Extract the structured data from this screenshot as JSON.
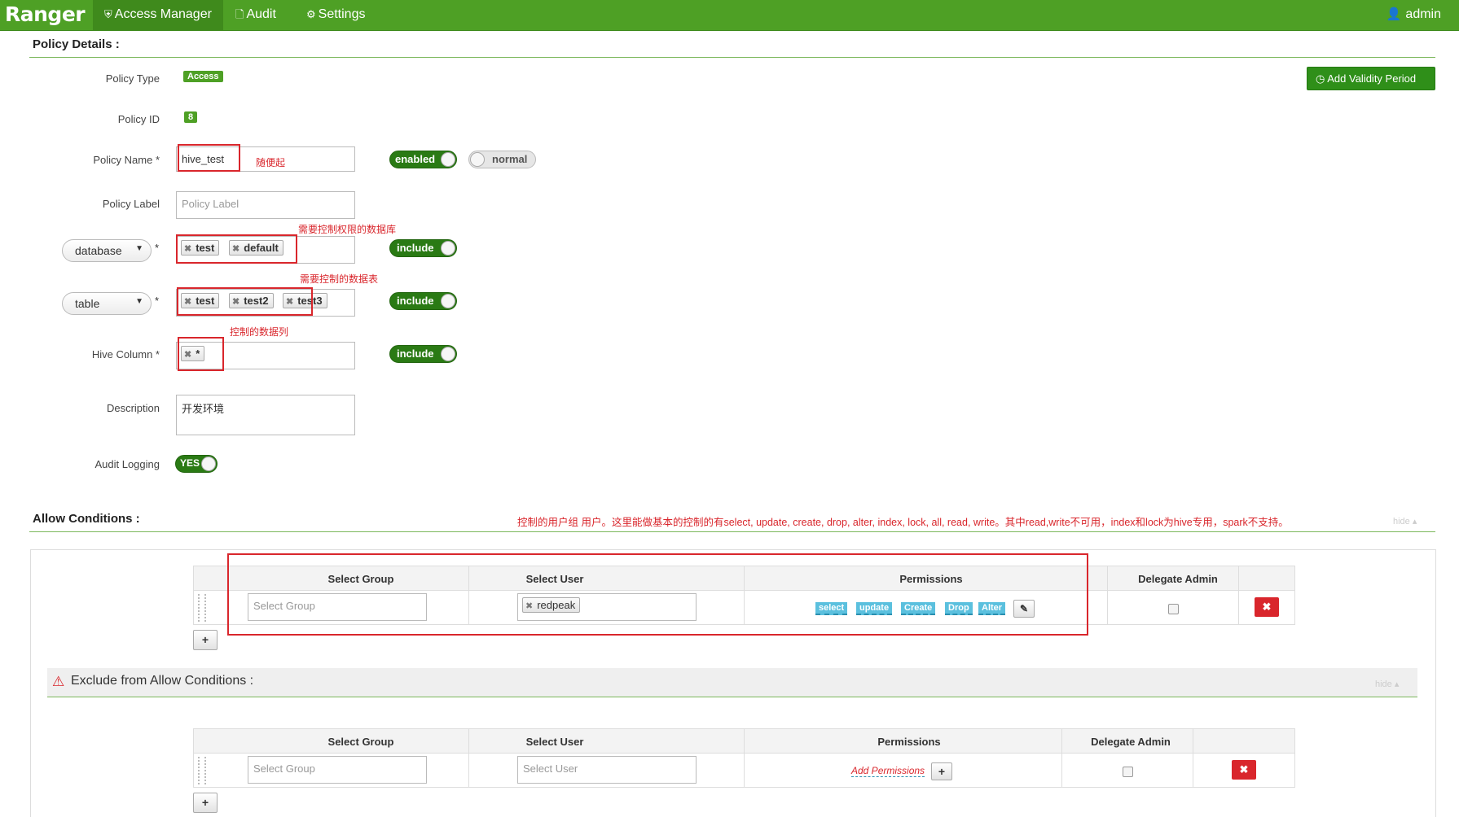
{
  "topbar": {
    "brand": "Ranger",
    "nav": [
      {
        "label": "Access Manager",
        "icon": "shield-icon"
      },
      {
        "label": "Audit",
        "icon": "file-icon"
      },
      {
        "label": "Settings",
        "icon": "gear-icon"
      }
    ],
    "user": "admin"
  },
  "policy_details": {
    "title": "Policy Details :",
    "add_validity_label": "Add Validity Period",
    "policy_type_label": "Policy Type",
    "policy_type_value": "Access",
    "policy_id_label": "Policy ID",
    "policy_id_value": "8",
    "policy_name_label": "Policy Name *",
    "policy_name_value": "hive_test",
    "policy_name_note": "随便起",
    "enabled_toggle": "enabled",
    "normal_toggle": "normal",
    "policy_label_label": "Policy Label",
    "policy_label_placeholder": "Policy Label",
    "database_select": "database",
    "database_required": "*",
    "database_note": "需要控制权限的数据库",
    "database_tags": [
      "test",
      "default"
    ],
    "database_toggle": "include",
    "table_select": "table",
    "table_required": "*",
    "table_note": "需要控制的数据表",
    "table_tags": [
      "test",
      "test2",
      "test3"
    ],
    "table_toggle": "include",
    "column_label": "Hive Column *",
    "column_note": "控制的数据列",
    "column_tags": [
      "*"
    ],
    "column_toggle": "include",
    "description_label": "Description",
    "description_value": "开发环境",
    "audit_label": "Audit Logging",
    "audit_toggle": "YES"
  },
  "allow": {
    "title": "Allow Conditions :",
    "note": "控制的用户组 用户。这里能做基本的控制的有select, update, create, drop, alter, index, lock, all, read, write。其中read,write不可用，index和lock为hive专用，spark不支持。",
    "hide": "hide",
    "headers": [
      "Select Group",
      "Select User",
      "Permissions",
      "Delegate Admin"
    ],
    "group_placeholder": "Select Group",
    "user_tag": "redpeak",
    "permissions": [
      "select",
      "update",
      "Create",
      "Drop",
      "Alter"
    ],
    "add_row": "+"
  },
  "exclude": {
    "title": "Exclude from Allow Conditions :",
    "hide": "hide",
    "headers": [
      "Select Group",
      "Select User",
      "Permissions",
      "Delegate Admin"
    ],
    "group_placeholder": "Select Group",
    "user_placeholder": "Select User",
    "add_permissions": "Add Permissions",
    "add_row": "+"
  },
  "colors": {
    "brand_green": "#4ea025",
    "annotation_red": "#d9262c",
    "perm_blue": "#5bc0de"
  }
}
